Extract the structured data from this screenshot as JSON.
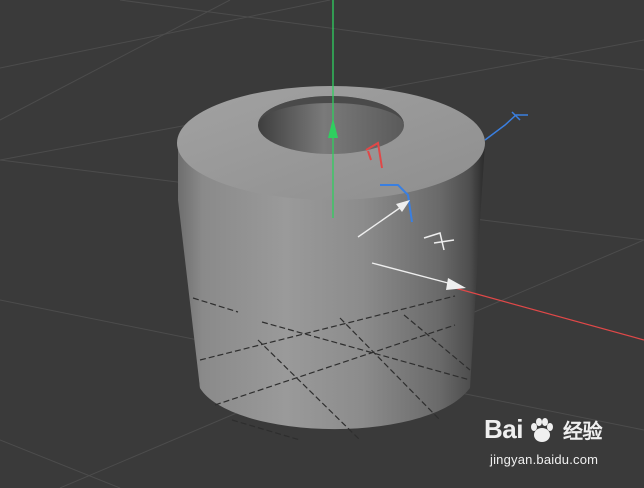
{
  "scene": {
    "object": "tube",
    "background_color": "#3a3a3a",
    "grid_color": "#4a4a4a",
    "axis_colors": {
      "x": "#e04848",
      "y": "#2fcf5f",
      "z": "#3a7fe0"
    },
    "object_color": "#8a8a8a"
  },
  "watermark": {
    "brand_left": "Bai",
    "brand_right": "经验",
    "url": "jingyan.baidu.com",
    "icon": "paw-icon"
  }
}
